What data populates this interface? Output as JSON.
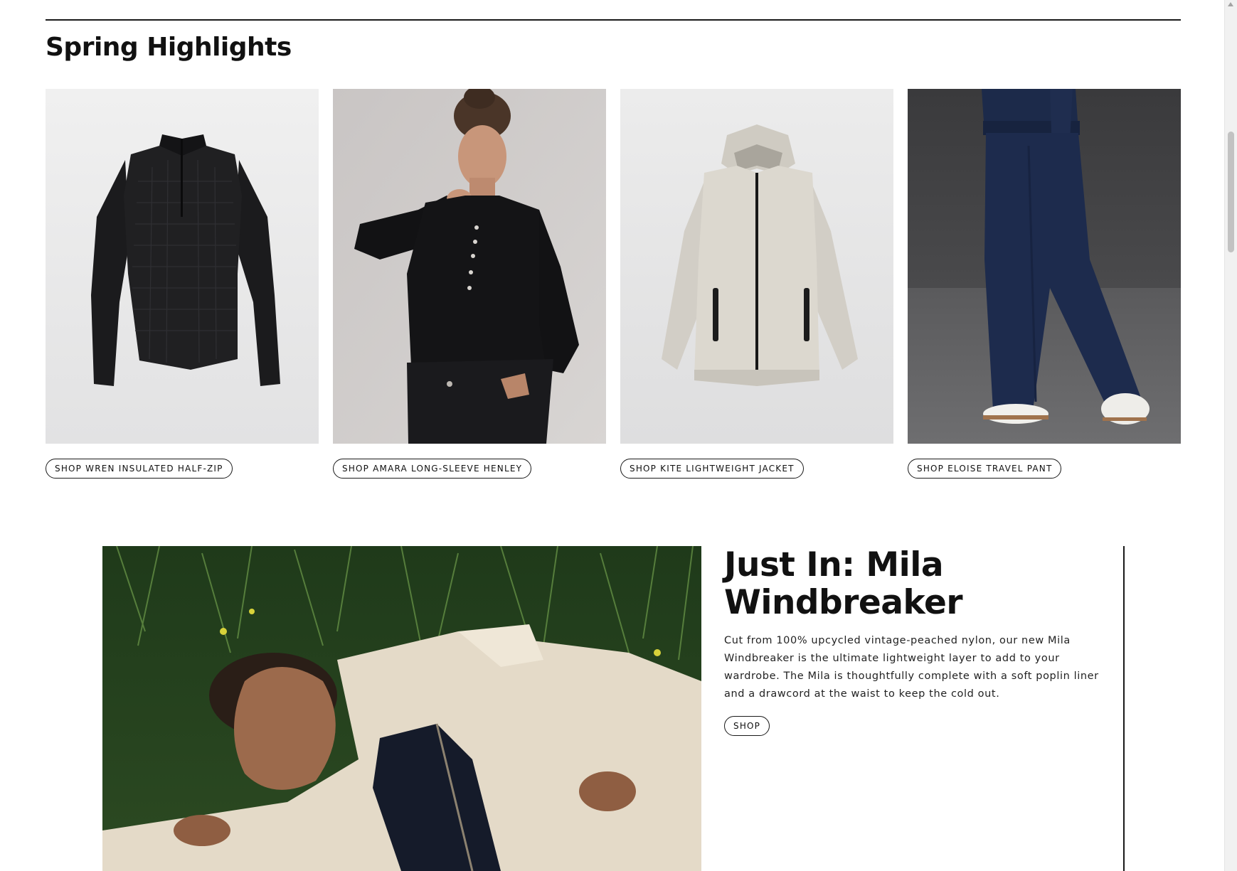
{
  "section": {
    "title": "Spring Highlights"
  },
  "products": [
    {
      "name": "Wren Insulated Half-Zip",
      "button_label": "SHOP WREN INSULATED HALF-ZIP",
      "image": "black quilted half-zip pullover"
    },
    {
      "name": "Amara Long-Sleeve Henley",
      "button_label": "SHOP AMARA LONG-SLEEVE HENLEY",
      "image": "model in black long-sleeve henley"
    },
    {
      "name": "Kite Lightweight Jacket",
      "button_label": "SHOP KITE LIGHTWEIGHT JACKET",
      "image": "stone hooded lightweight jacket"
    },
    {
      "name": "Eloise Travel Pant",
      "button_label": "SHOP ELOISE TRAVEL PANT",
      "image": "model in navy wide-leg travel pant"
    }
  ],
  "feature": {
    "title": "Just In: Mila Windbreaker",
    "body": "Cut from 100% upcycled vintage-peached nylon, our new Mila Windbreaker is the ultimate lightweight layer to add to your wardrobe. The Mila is thoughtfully complete with a soft poplin liner and a drawcord at the waist to keep the cold out.",
    "button_label": "SHOP",
    "image": "woman lying in grass wearing cream windbreaker"
  },
  "colors": {
    "text": "#111111",
    "rule": "#1a1a1a",
    "background": "#ffffff"
  }
}
